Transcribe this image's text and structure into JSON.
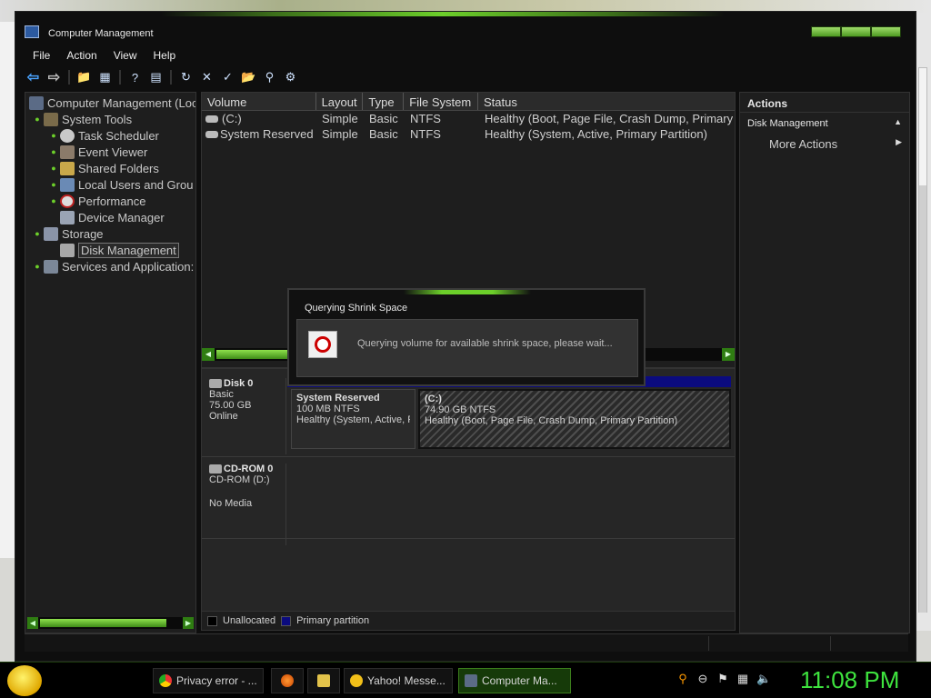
{
  "window": {
    "title": "Computer Management"
  },
  "menu": [
    "File",
    "Action",
    "View",
    "Help"
  ],
  "tree": {
    "root": "Computer Management (Loc",
    "items": [
      {
        "label": "System Tools",
        "level": 1
      },
      {
        "label": "Task Scheduler",
        "level": 2
      },
      {
        "label": "Event Viewer",
        "level": 2
      },
      {
        "label": "Shared Folders",
        "level": 2
      },
      {
        "label": "Local Users and Grou",
        "level": 2
      },
      {
        "label": "Performance",
        "level": 2
      },
      {
        "label": "Device Manager",
        "level": 2
      },
      {
        "label": "Storage",
        "level": 1
      },
      {
        "label": "Disk Management",
        "level": 2,
        "selected": true
      },
      {
        "label": "Services and Application:",
        "level": 1
      }
    ]
  },
  "volumes": {
    "headers": [
      "Volume",
      "Layout",
      "Type",
      "File System",
      "Status"
    ],
    "rows": [
      [
        "(C:)",
        "Simple",
        "Basic",
        "NTFS",
        "Healthy (Boot, Page File, Crash Dump, Primary"
      ],
      [
        "System Reserved",
        "Simple",
        "Basic",
        "NTFS",
        "Healthy (System, Active, Primary Partition)"
      ]
    ]
  },
  "disks": [
    {
      "name": "Disk 0",
      "type": "Basic",
      "size": "75.00 GB",
      "state": "Online"
    },
    {
      "name": "CD-ROM 0",
      "type": "CD-ROM (D:)",
      "size": "",
      "state": "No Media"
    }
  ],
  "partitions": [
    {
      "name": "System Reserved",
      "size": "100 MB NTFS",
      "status": "Healthy (System, Active, P"
    },
    {
      "name": "(C:)",
      "size": "74.90 GB NTFS",
      "status": "Healthy (Boot, Page File, Crash Dump, Primary Partition)"
    }
  ],
  "legend": [
    "Unallocated",
    "Primary partition"
  ],
  "actions": {
    "header": "Actions",
    "section": "Disk Management",
    "more": "More Actions"
  },
  "dialog": {
    "title": "Querying Shrink Space",
    "message": "Querying volume for available shrink space, please wait..."
  },
  "taskbar": {
    "tasks": [
      "Privacy error - ...",
      "Yahoo! Messe...",
      "Computer Ma..."
    ],
    "clock": "11:08 PM"
  },
  "colors": {
    "accent": "#6ccf2a",
    "primary_partition": "#0b0b7e",
    "clock": "#3ee33e"
  }
}
